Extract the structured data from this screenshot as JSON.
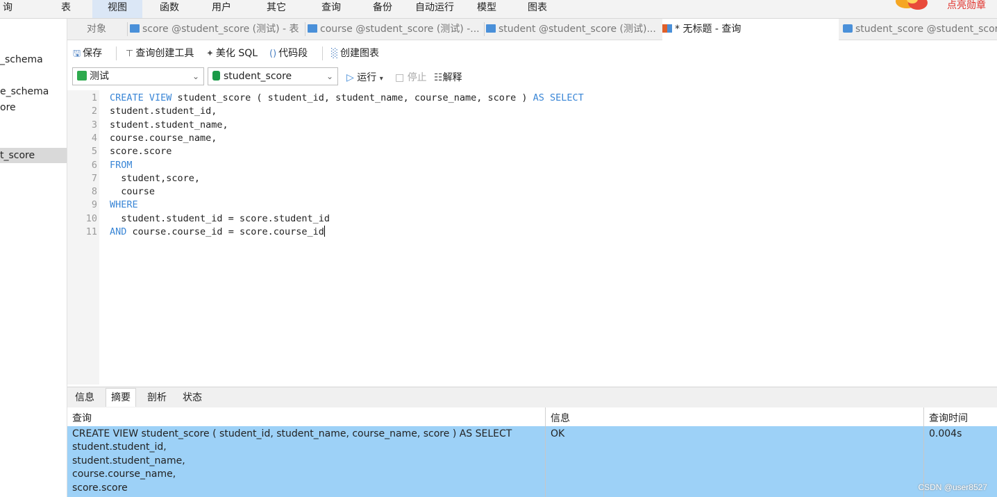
{
  "menu": [
    {
      "label": "询"
    },
    {
      "label": "表"
    },
    {
      "label": "视图"
    },
    {
      "label": "函数"
    },
    {
      "label": "用户"
    },
    {
      "label": "其它"
    },
    {
      "label": "查询"
    },
    {
      "label": "备份"
    },
    {
      "label": "自动运行"
    },
    {
      "label": "模型"
    },
    {
      "label": "图表"
    }
  ],
  "promo": {
    "text": "点亮勋章"
  },
  "navigator": {
    "items": [
      {
        "label": "_schema"
      },
      {
        "label": "e_schema"
      },
      {
        "label": "ore"
      },
      {
        "label": "t_score",
        "selected": true
      }
    ]
  },
  "tabs": [
    {
      "label": "对象"
    },
    {
      "label": "score @student_score (测试) - 表"
    },
    {
      "label": "course @student_score (测试) -..."
    },
    {
      "label": "student @student_score (测试)..."
    },
    {
      "label": "* 无标题 - 查询",
      "active": true
    },
    {
      "label": "student_score @student_score"
    }
  ],
  "toolbar": {
    "save": "保存",
    "query_builder": "查询创建工具",
    "beautify": "美化 SQL",
    "snippet": "代码段",
    "create_chart": "创建图表"
  },
  "connection": {
    "connection_value": "测试",
    "database_value": "student_score",
    "run": "运行",
    "stop": "停止",
    "explain": "解释"
  },
  "editor": {
    "lines": [
      {
        "n": "1",
        "parts": [
          {
            "t": "CREATE VIEW",
            "kw": true
          },
          {
            "t": " student_score ( student_id, student_name, course_name, score ) ",
            "kw": false
          },
          {
            "t": "AS SELECT",
            "kw": true
          }
        ]
      },
      {
        "n": "2",
        "parts": [
          {
            "t": "student.student_id,",
            "kw": false
          }
        ]
      },
      {
        "n": "3",
        "parts": [
          {
            "t": "student.student_name,",
            "kw": false
          }
        ]
      },
      {
        "n": "4",
        "parts": [
          {
            "t": "course.course_name,",
            "kw": false
          }
        ]
      },
      {
        "n": "5",
        "parts": [
          {
            "t": "score.score",
            "kw": false
          }
        ]
      },
      {
        "n": "6",
        "parts": [
          {
            "t": "FROM",
            "kw": true
          }
        ]
      },
      {
        "n": "7",
        "parts": [
          {
            "t": "  student,score,",
            "kw": false
          }
        ]
      },
      {
        "n": "8",
        "parts": [
          {
            "t": "  course",
            "kw": false
          }
        ]
      },
      {
        "n": "9",
        "parts": [
          {
            "t": "WHERE",
            "kw": true
          }
        ]
      },
      {
        "n": "10",
        "parts": [
          {
            "t": "  student.student_id = score.student_id",
            "kw": false
          }
        ]
      },
      {
        "n": "11",
        "parts": [
          {
            "t": "AND",
            "kw": true
          },
          {
            "t": " course.course_id = score.course_id",
            "kw": false
          }
        ]
      }
    ]
  },
  "result_tabs": [
    {
      "label": "信息"
    },
    {
      "label": "摘要",
      "active": true
    },
    {
      "label": "剖析"
    },
    {
      "label": "状态"
    }
  ],
  "result_grid": {
    "headers": [
      "查询",
      "信息",
      "查询时间"
    ],
    "rows": [
      [
        "CREATE VIEW student_score ( student_id, student_name, course_name, score ) AS SELECT\nstudent.student_id,\nstudent.student_name,\ncourse.course_name,\nscore.score",
        "OK",
        "0.004s"
      ]
    ]
  },
  "watermark": "CSDN @user8527"
}
